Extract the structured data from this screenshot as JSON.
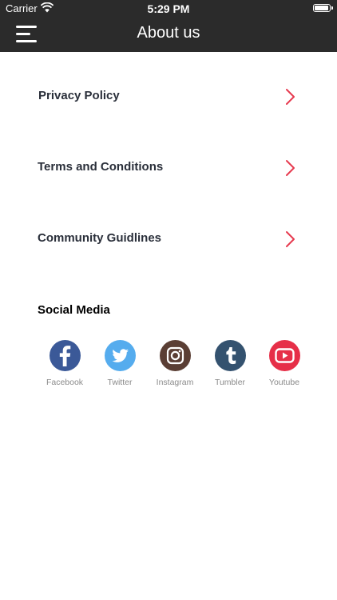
{
  "status_bar": {
    "carrier": "Carrier",
    "time": "5:29 PM"
  },
  "nav": {
    "title": "About us",
    "menu_icon": "hamburger-menu-icon"
  },
  "menu": [
    {
      "label": "Privacy Policy",
      "icon": "chevron-right-icon"
    },
    {
      "label": "Terms and Conditions",
      "icon": "chevron-right-icon"
    },
    {
      "label": "Community Guidlines",
      "icon": "chevron-right-icon"
    }
  ],
  "social": {
    "title": "Social Media",
    "items": [
      {
        "label": "Facebook",
        "icon": "facebook-icon",
        "color": "#3b5998"
      },
      {
        "label": "Twitter",
        "icon": "twitter-icon",
        "color": "#55acee"
      },
      {
        "label": "Instagram",
        "icon": "instagram-icon",
        "color": "#5a3e34"
      },
      {
        "label": "Tumbler",
        "icon": "tumblr-icon",
        "color": "#34526f"
      },
      {
        "label": "Youtube",
        "icon": "youtube-icon",
        "color": "#e62f48"
      }
    ]
  },
  "colors": {
    "header": "#2b2b2b",
    "accent": "#e63a4f",
    "menu_text": "#2a2f3a"
  }
}
